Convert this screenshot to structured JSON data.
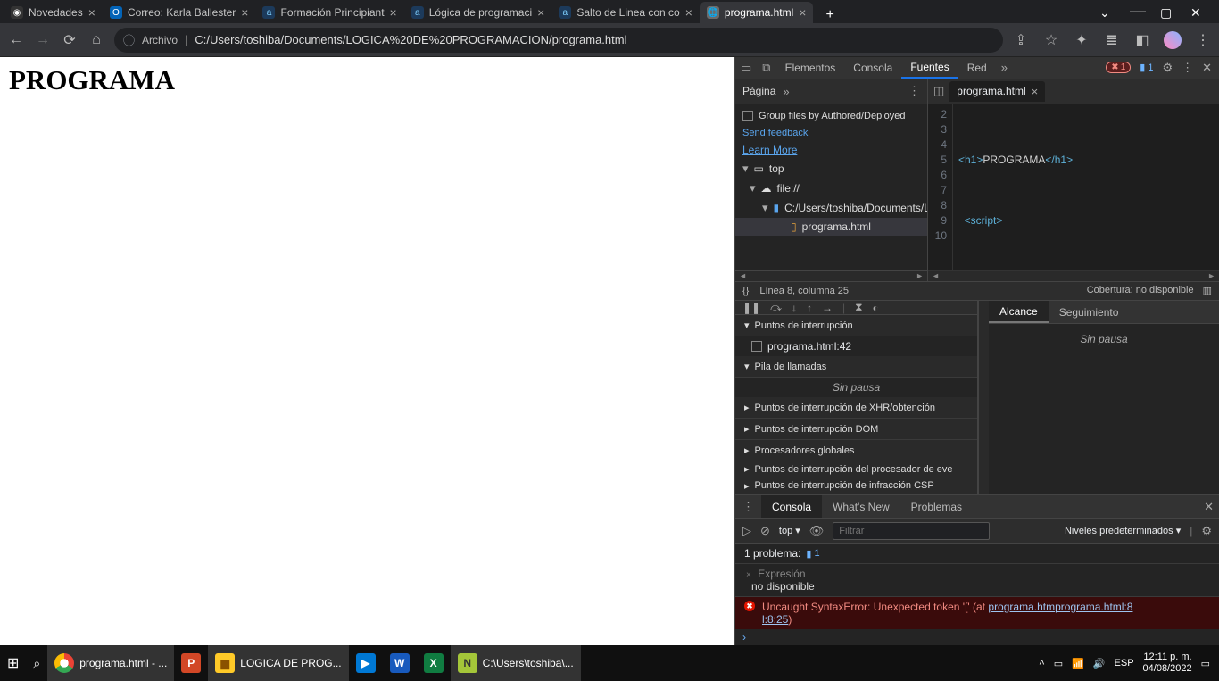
{
  "tabs": [
    {
      "title": "Novedades"
    },
    {
      "title": "Correo: Karla Ballester"
    },
    {
      "title": "Formación Principiant"
    },
    {
      "title": "Lógica de programaci"
    },
    {
      "title": "Salto de Linea con co"
    },
    {
      "title": "programa.html"
    }
  ],
  "addr": {
    "scheme": "Archivo",
    "path": "C:/Users/toshiba/Documents/LOGICA%20DE%20PROGRAMACION/programa.html"
  },
  "page": {
    "heading": "PROGRAMA"
  },
  "devtools": {
    "tabs": {
      "elements": "Elementos",
      "console": "Consola",
      "sources": "Fuentes",
      "network": "Red"
    },
    "error_count": "1",
    "issue_count": "1",
    "nav": {
      "page": "Página",
      "group": "Group files by Authored/Deployed",
      "feedback": "Send feedback",
      "learn": "Learn More",
      "top": "top",
      "file": "file://",
      "folder": "C:/Users/toshiba/Documents/L",
      "item": "programa.html"
    },
    "openfile": "programa.html",
    "code_lines": [
      "2",
      "3",
      "4",
      "5",
      "6",
      "7",
      "8",
      "9",
      "10"
    ],
    "status": {
      "pos": "Línea 8, columna 25",
      "cov": "Cobertura: no disponible"
    },
    "sections": {
      "bp": "Puntos de interrupción",
      "bp_item": "programa.html:42",
      "callstack": "Pila de llamadas",
      "nopause": "Sin pausa",
      "xhr": "Puntos de interrupción de XHR/obtención",
      "dom": "Puntos de interrupción DOM",
      "global": "Procesadores globales",
      "event": "Puntos de interrupción del procesador de eve",
      "csp": "Puntos de interrupción de infracción CSP"
    },
    "scope": {
      "alcance": "Alcance",
      "segui": "Seguimiento",
      "nopause": "Sin pausa"
    }
  },
  "drawer": {
    "tabs": {
      "consola": "Consola",
      "whatsnew": "What's New",
      "problemas": "Problemas"
    },
    "filter": {
      "context": "top",
      "placeholder": "Filtrar",
      "levels": "Niveles predeterminados"
    },
    "problems": "1 problema:",
    "problems_count": "1",
    "expr": {
      "label": "Expresión",
      "val": "no disponible"
    },
    "error": {
      "msg": "Uncaught SyntaxError: Unexpected token '[' (at ",
      "src1": "programa.htm",
      "src2": "programa.html:8",
      "tail": "l:8:25",
      "paren": ")"
    }
  },
  "taskbar": {
    "items": [
      {
        "label": "programa.html - ..."
      },
      {
        "label": ""
      },
      {
        "label": "LOGICA DE PROG..."
      },
      {
        "label": ""
      },
      {
        "label": ""
      },
      {
        "label": ""
      },
      {
        "label": "C:\\Users\\toshiba\\..."
      }
    ],
    "lang": "ESP",
    "time": "12:11 p. m.",
    "date": "04/08/2022"
  }
}
